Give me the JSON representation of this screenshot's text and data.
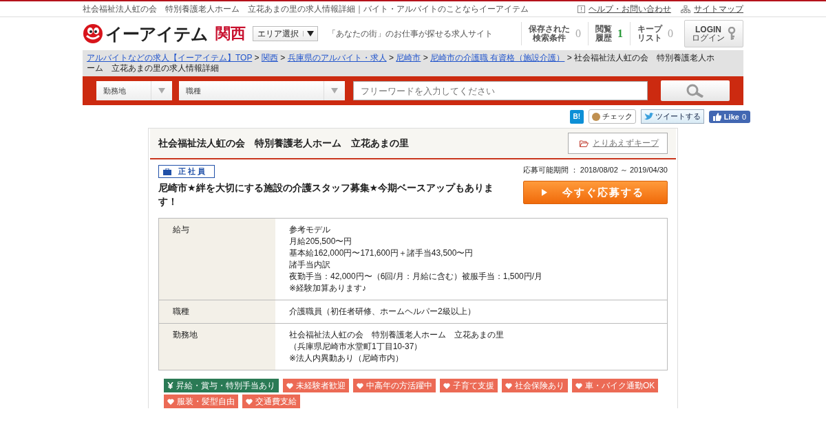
{
  "top_bar": {
    "title": "社会福祉法人虹の会　特別養護老人ホーム　立花あまの里の求人情報詳細｜バイト・アルバイトのことならイーアイテム",
    "links": [
      "ヘルプ・お問い合わせ",
      "サイトマップ"
    ]
  },
  "header": {
    "logo_text": "イーアイテム",
    "region": "関西",
    "area_select": "エリア選択",
    "tagline": "「あなたの街」のお仕事が探せる求人サイト",
    "counters": [
      {
        "label_lines": [
          "保存された",
          "検索条件"
        ],
        "count": "0",
        "highlighted": false
      },
      {
        "label_lines": [
          "閲覧",
          "履歴"
        ],
        "count": "1",
        "highlighted": true
      },
      {
        "label_lines": [
          "キープ",
          "リスト"
        ],
        "count": "0",
        "highlighted": false
      }
    ],
    "login": {
      "label": "LOGIN",
      "sub": "ログイン"
    }
  },
  "breadcrumb": {
    "separator": ">",
    "links": [
      "アルバイトなどの求人【イーアイテム】TOP",
      "関西",
      "兵庫県のアルバイト・求人",
      "尼崎市",
      "尼崎市の介護職 有資格（施設介護）"
    ],
    "current": "社会福祉法人虹の会　特別養護老人ホーム　立花あまの里の求人情報詳細"
  },
  "search": {
    "location_placeholder": "勤務地",
    "job_placeholder": "職種",
    "keyword_placeholder": "フリーワードを入力してください"
  },
  "social": {
    "hatena": "B!",
    "check": "チェック",
    "tweet": "ツイートする",
    "like": "Like",
    "like_count": "0"
  },
  "job": {
    "company": "社会福祉法人虹の会　特別養護老人ホーム　立花あまの里",
    "keep": "とりあえずキープ",
    "employment_type": "正社員",
    "period": "応募可能期間 ： 2018/08/02 ～ 2019/04/30",
    "headline": "尼崎市★絆を大切にする施設の介護スタッフ募集★今期ベースアップもあります！",
    "apply": "今すぐ応募する",
    "details": [
      {
        "label": "給与",
        "lines": [
          "参考モデル",
          "月給205,500〜円",
          "基本給162,000円〜171,600円＋諸手当43,500〜円",
          "諸手当内訳",
          "夜勤手当：42,000円〜（6回/月：月給に含む）被服手当：1,500円/月",
          "※経験加算あります♪"
        ]
      },
      {
        "label": "職種",
        "lines": [
          "介護職員（初任者研修、ホームヘルパー2級以上）"
        ]
      },
      {
        "label": "勤務地",
        "lines": [
          "社会福祉法人虹の会　特別養護老人ホーム　立花あまの里",
          "（兵庫県尼崎市水堂町1丁目10-37）",
          "※法人内異動あり（尼崎市内）"
        ]
      }
    ],
    "tags": [
      {
        "kind": "yen",
        "text": "昇給・賞与・特別手当あり"
      },
      {
        "kind": "heart",
        "text": "未経験者歓迎"
      },
      {
        "kind": "heart",
        "text": "中高年の方活躍中"
      },
      {
        "kind": "heart",
        "text": "子育て支援"
      },
      {
        "kind": "heart",
        "text": "社会保険あり"
      },
      {
        "kind": "heart",
        "text": "車・バイク通勤OK"
      },
      {
        "kind": "heart",
        "text": "服装・髪型自由"
      },
      {
        "kind": "heart",
        "text": "交通費支給"
      }
    ]
  }
}
